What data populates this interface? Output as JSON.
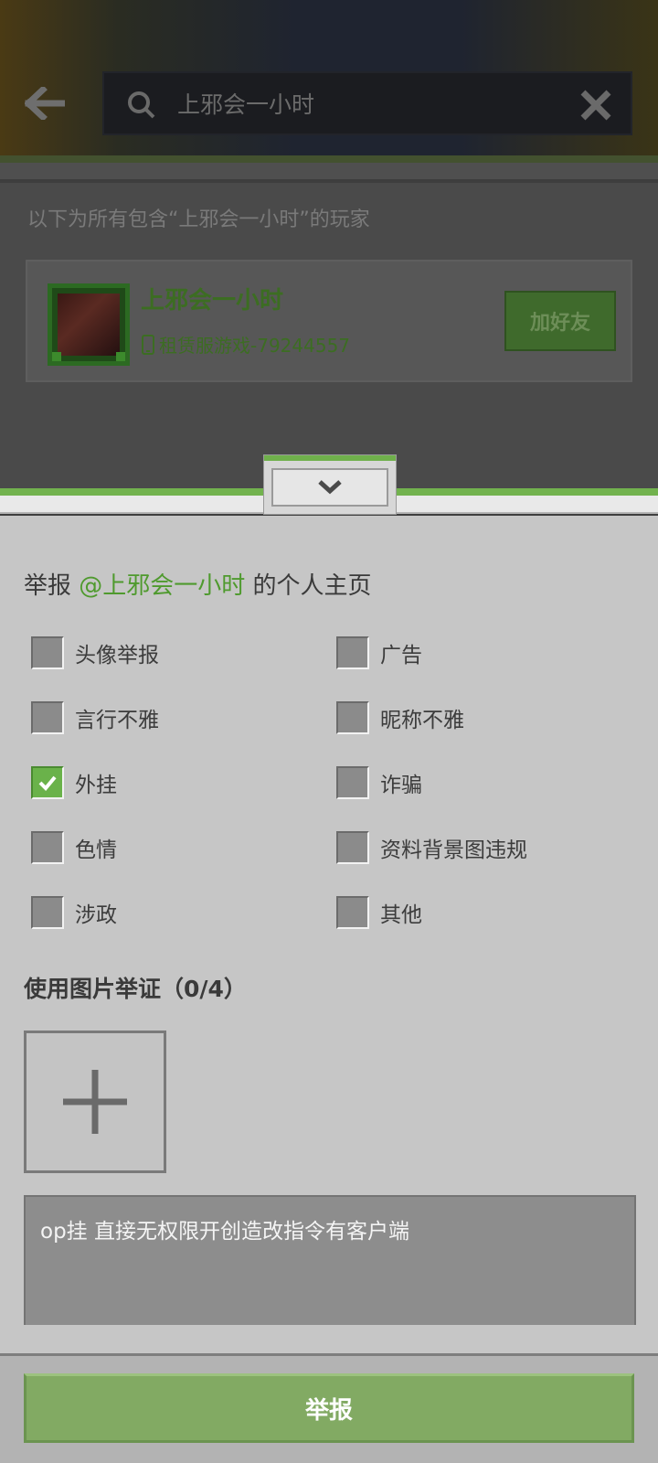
{
  "search": {
    "query": "上邪会一小时"
  },
  "results": {
    "hint": "以下为所有包含“上邪会一小时”的玩家",
    "player": {
      "name": "上邪会一小时",
      "server": "租赁服游戏-79244557",
      "add_friend_label": "加好友"
    }
  },
  "report": {
    "title_prefix": "举报 ",
    "mention": "@上邪会一小时",
    "title_suffix": " 的个人主页",
    "reasons": [
      {
        "label": "头像举报",
        "checked": false
      },
      {
        "label": "广告",
        "checked": false
      },
      {
        "label": "言行不雅",
        "checked": false
      },
      {
        "label": "昵称不雅",
        "checked": false
      },
      {
        "label": "外挂",
        "checked": true
      },
      {
        "label": "诈骗",
        "checked": false
      },
      {
        "label": "色情",
        "checked": false
      },
      {
        "label": "资料背景图违规",
        "checked": false
      },
      {
        "label": "涉政",
        "checked": false
      },
      {
        "label": "其他",
        "checked": false
      }
    ],
    "evidence_title": "使用图片举证（0/4）",
    "description": "op挂 直接无权限开创造改指令有客户端",
    "submit_label": "举报"
  },
  "colors": {
    "accent_green": "#6fb04b",
    "mention_green": "#4f9a2e",
    "submit_green": "#82aa63"
  }
}
